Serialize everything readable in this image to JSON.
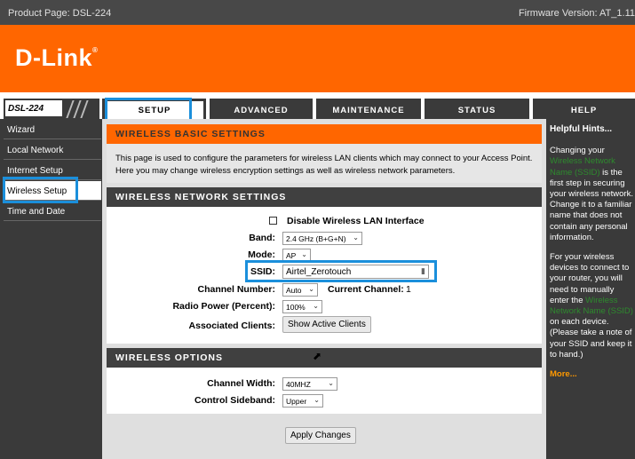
{
  "topbar": {
    "product": "Product Page: DSL-224",
    "firmware": "Firmware Version: AT_1.11"
  },
  "brand": {
    "logo": "D-Link",
    "trademark": "®",
    "color": "#ff6600"
  },
  "model_tab": "DSL-224",
  "tabs": [
    {
      "label": "SETUP",
      "active": true
    },
    {
      "label": "ADVANCED"
    },
    {
      "label": "MAINTENANCE"
    },
    {
      "label": "STATUS"
    },
    {
      "label": "HELP"
    }
  ],
  "sidebar": {
    "items": [
      {
        "label": "Wizard"
      },
      {
        "label": "Local Network"
      },
      {
        "label": "Internet Setup"
      },
      {
        "label": "Wireless Setup",
        "active": true
      },
      {
        "label": "Time and Date"
      }
    ]
  },
  "basic": {
    "title": "WIRELESS BASIC SETTINGS",
    "description": "This page is used to configure the parameters for wireless LAN clients which may connect to your Access Point. Here you may change wireless encryption settings as well as wireless network parameters."
  },
  "network": {
    "title": "WIRELESS NETWORK SETTINGS",
    "disable_label": "Disable Wireless LAN Interface",
    "band_label": "Band:",
    "band_value": "2.4 GHz (B+G+N)",
    "mode_label": "Mode:",
    "mode_value": "AP",
    "ssid_label": "SSID:",
    "ssid_value": "Airtel_Zerotouch",
    "channel_label": "Channel Number:",
    "channel_value": "Auto",
    "current_channel_label": "Current Channel:",
    "current_channel_value": "1",
    "power_label": "Radio Power (Percent):",
    "power_value": "100%",
    "clients_label": "Associated Clients:",
    "clients_button": "Show Active Clients"
  },
  "options": {
    "title": "WIRELESS OPTIONS",
    "width_label": "Channel Width:",
    "width_value": "40MHZ",
    "sideband_label": "Control Sideband:",
    "sideband_value": "Upper"
  },
  "apply_button": "Apply Changes",
  "help": {
    "title": "Helpful Hints...",
    "p1_a": "Changing your ",
    "p1_green": "Wireless Network Name (SSID)",
    "p1_b": " is the first step in securing your wireless network. Change it to a familiar name that does not contain any personal information.",
    "p2_a": "For your wireless devices to connect to your router, you will need to manually enter the ",
    "p2_green": "Wireless Network Name (SSID)",
    "p2_b": " on each device. (Please take a note of your SSID and keep it to hand.)",
    "more": "More..."
  },
  "highlight_color": "#1b8fdb"
}
